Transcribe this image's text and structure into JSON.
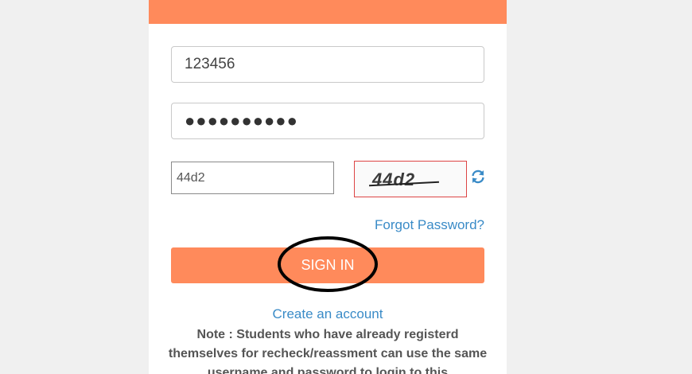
{
  "form": {
    "username_value": "123456",
    "password_value": "●●●●●●●●●●",
    "captcha_input_value": "44d2",
    "captcha_image_text": "44d2"
  },
  "links": {
    "forgot_password": "Forgot Password?",
    "create_account": "Create an account"
  },
  "buttons": {
    "sign_in": "SIGN IN"
  },
  "note": "Note : Students who have already registerd themselves for recheck/reassment can use the same username and password to login to this",
  "colors": {
    "brand": "#ff8a5b",
    "link": "#3a8bc7",
    "annotation": "#000000",
    "captcha_border": "#dd4444"
  },
  "icons": {
    "refresh": "refresh-icon"
  }
}
